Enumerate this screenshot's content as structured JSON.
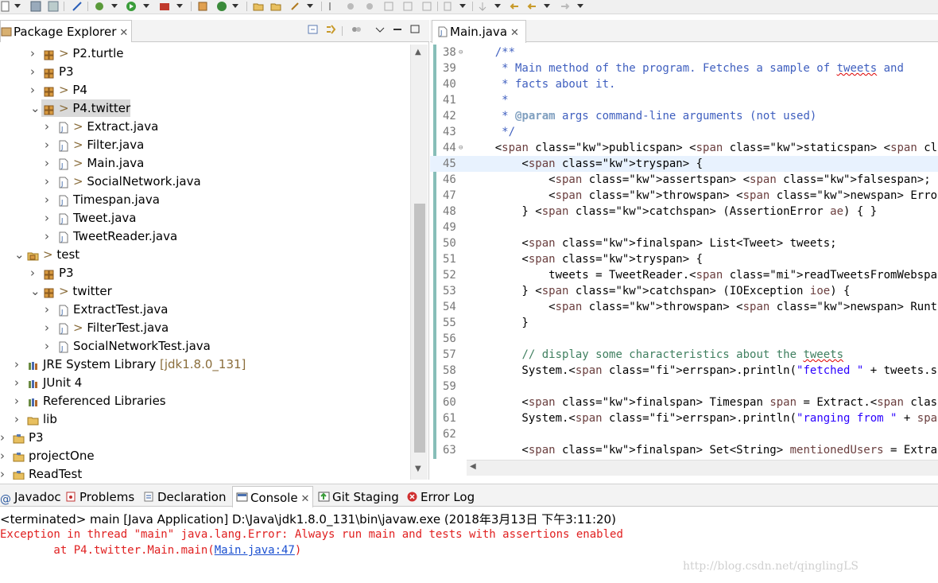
{
  "package_explorer": {
    "title": "Package Explorer",
    "tree": [
      {
        "label": "P2.turtle",
        "decor": ">",
        "icon": "package-icon",
        "twist": ">"
      },
      {
        "label": "P3",
        "decor": "",
        "icon": "package-icon",
        "twist": ">"
      },
      {
        "label": "P4",
        "decor": ">",
        "icon": "package-icon",
        "twist": ">"
      },
      {
        "label": "P4.twitter",
        "decor": ">",
        "icon": "package-icon",
        "twist": "v"
      },
      {
        "label": "Extract.java",
        "decor": ">",
        "icon": "java-file-icon",
        "twist": ">"
      },
      {
        "label": "Filter.java",
        "decor": ">",
        "icon": "java-file-icon",
        "twist": ">"
      },
      {
        "label": "Main.java",
        "decor": ">",
        "icon": "java-file-icon",
        "twist": ">"
      },
      {
        "label": "SocialNetwork.java",
        "decor": ">",
        "icon": "java-file-icon",
        "twist": ">"
      },
      {
        "label": "Timespan.java",
        "decor": "",
        "icon": "java-file-icon",
        "twist": ">"
      },
      {
        "label": "Tweet.java",
        "decor": "",
        "icon": "java-file-icon",
        "twist": ">"
      },
      {
        "label": "TweetReader.java",
        "decor": "",
        "icon": "java-file-icon",
        "twist": ">"
      },
      {
        "label": "test",
        "decor": ">",
        "icon": "source-folder-icon",
        "twist": "v"
      },
      {
        "label": "P3",
        "decor": "",
        "icon": "package-icon",
        "twist": ">"
      },
      {
        "label": "twitter",
        "decor": ">",
        "icon": "package-icon",
        "twist": "v"
      },
      {
        "label": "ExtractTest.java",
        "decor": "",
        "icon": "java-file-icon",
        "twist": ">"
      },
      {
        "label": "FilterTest.java",
        "decor": ">",
        "icon": "java-file-icon",
        "twist": ">"
      },
      {
        "label": "SocialNetworkTest.java",
        "decor": "",
        "icon": "java-file-icon",
        "twist": ">"
      },
      {
        "label": "JRE System Library",
        "suffix": "[jdk1.8.0_131]",
        "decor": "",
        "icon": "library-icon",
        "twist": ">"
      },
      {
        "label": "JUnit 4",
        "decor": "",
        "icon": "library-icon",
        "twist": ">"
      },
      {
        "label": "Referenced Libraries",
        "decor": "",
        "icon": "library-icon",
        "twist": ">"
      },
      {
        "label": "lib",
        "decor": "",
        "icon": "folder-icon",
        "twist": ">"
      },
      {
        "label": "P3",
        "decor": "",
        "icon": "project-icon",
        "twist": ">"
      },
      {
        "label": "projectOne",
        "decor": "",
        "icon": "project-icon",
        "twist": ">"
      },
      {
        "label": "ReadTest",
        "decor": "",
        "icon": "project-icon",
        "twist": ">"
      }
    ]
  },
  "editor": {
    "tab_title": "Main.java",
    "line_numbers": [
      "38",
      "39",
      "40",
      "41",
      "42",
      "43",
      "44",
      "45",
      "46",
      "47",
      "48",
      "49",
      "50",
      "51",
      "52",
      "53",
      "54",
      "55",
      "56",
      "57",
      "58",
      "59",
      "60",
      "61",
      "62",
      "63"
    ],
    "lines": [
      "    /**",
      "     * Main method of the program. Fetches a sample of tweets and",
      "     * facts about it.",
      "     *",
      "     * @param args command-line arguments (not used)",
      "     */",
      "    public static void main(String[] args) {",
      "        try {",
      "            assert false;",
      "            throw new Error(\"Always run main and tests with assert",
      "        } catch (AssertionError ae) { }",
      "",
      "        final List<Tweet> tweets;",
      "        try {",
      "            tweets = TweetReader.readTweetsFromWeb(SAMPLE_SERVER);",
      "        } catch (IOException ioe) {",
      "            throw new RuntimeException(ioe);",
      "        }",
      "",
      "        // display some characteristics about the tweets",
      "        System.err.println(\"fetched \" + tweets.size() + \" tweets\");",
      "",
      "        final Timespan span = Extract.getTimespan(tweets);",
      "        System.err.println(\"ranging from \" + span.getStart() + \" t",
      "",
      "        final Set<String> mentionedUsers = Extract.getMentionedUse"
    ]
  },
  "bottom_tabs": [
    {
      "label": "Javadoc",
      "icon": "javadoc-icon"
    },
    {
      "label": "Problems",
      "icon": "problems-icon"
    },
    {
      "label": "Declaration",
      "icon": "declaration-icon"
    },
    {
      "label": "Console",
      "icon": "console-icon",
      "active": true
    },
    {
      "label": "Git Staging",
      "icon": "git-staging-icon"
    },
    {
      "label": "Error Log",
      "icon": "error-log-icon"
    }
  ],
  "console": {
    "header": "<terminated> main [Java Application] D:\\Java\\jdk1.8.0_131\\bin\\javaw.exe (2018年3月13日 下午3:11:20)",
    "error_line": "Exception in thread \"main\" java.lang.Error: Always run main and tests with assertions enabled",
    "stack_prefix": "        at P4.twitter.Main.main(",
    "stack_link": "Main.java:47",
    "stack_suffix": ")"
  },
  "watermark": "http://blog.csdn.net/qinglingLS",
  "colors": {
    "keyword": "#7f0055",
    "comment": "#3f5fbf",
    "string": "#2a00ff",
    "error": "#e02020",
    "selection": "#d9d9d9",
    "current_line": "#e8f2fe"
  }
}
